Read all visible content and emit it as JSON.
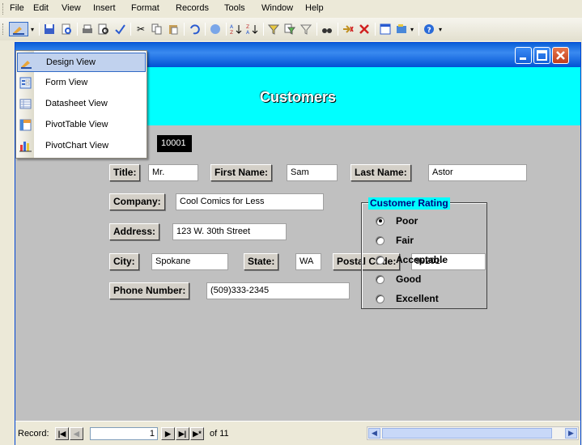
{
  "menubar": {
    "items": [
      {
        "label": "File"
      },
      {
        "label": "Edit"
      },
      {
        "label": "View"
      },
      {
        "label": "Insert"
      },
      {
        "label": "Format"
      },
      {
        "label": "Records"
      },
      {
        "label": "Tools"
      },
      {
        "label": "Window"
      },
      {
        "label": "Help"
      }
    ]
  },
  "view_menu": {
    "items": [
      {
        "label": "Design View",
        "icon": "design-view-icon",
        "selected": true
      },
      {
        "label": "Form View",
        "icon": "form-view-icon",
        "selected": false
      },
      {
        "label": "Datasheet View",
        "icon": "datasheet-view-icon",
        "selected": false
      },
      {
        "label": "PivotTable View",
        "icon": "pivottable-view-icon",
        "selected": false
      },
      {
        "label": "PivotChart View",
        "icon": "pivotchart-view-icon",
        "selected": false
      }
    ]
  },
  "form": {
    "title": "Customers",
    "customer_id": "10001",
    "title_label": "Title:",
    "title_value": "Mr.",
    "first_name_label": "First Name:",
    "first_name_value": "Sam",
    "last_name_label": "Last Name:",
    "last_name_value": "Astor",
    "company_label": "Company:",
    "company_value": "Cool Comics for Less",
    "address_label": "Address:",
    "address_value": "123 W. 30th Street",
    "city_label": "City:",
    "city_value": "Spokane",
    "state_label": "State:",
    "state_value": "WA",
    "postal_label": "Postal Code:",
    "postal_value": "99201-",
    "phone_label": "Phone Number:",
    "phone_value": "(509)333-2345",
    "rating": {
      "label": "Customer Rating",
      "options": [
        "Poor",
        "Fair",
        "Acceptable",
        "Good",
        "Excellent"
      ],
      "selected": "Poor"
    }
  },
  "navigation": {
    "record_label": "Record:",
    "current": "1",
    "total_text": "of 11"
  },
  "colors": {
    "header_band": "#00ffff",
    "form_background": "#c0c0c0",
    "titlebar": "#0a5fd8"
  }
}
